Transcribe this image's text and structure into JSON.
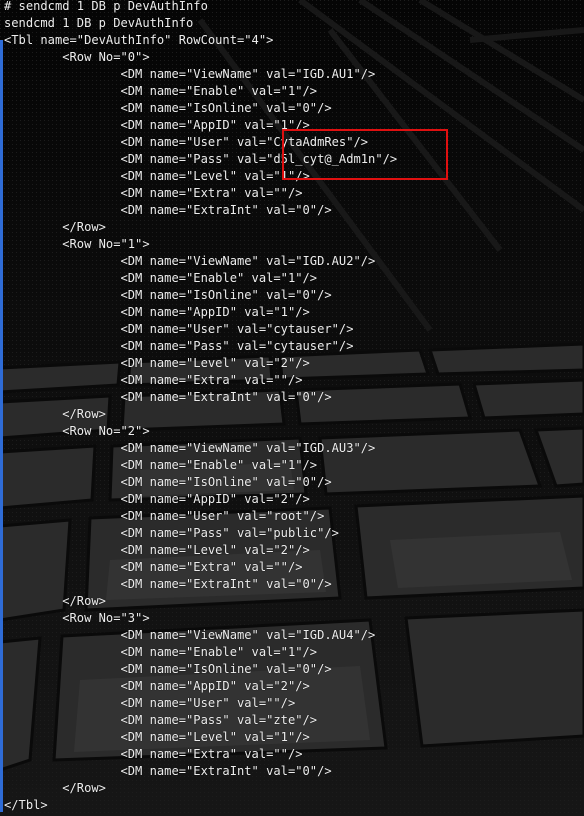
{
  "terminal": {
    "lines": [
      "# sendcmd 1 DB p DevAuthInfo",
      "sendcmd 1 DB p DevAuthInfo",
      "<Tbl name=\"DevAuthInfo\" RowCount=\"4\">",
      "        <Row No=\"0\">",
      "                <DM name=\"ViewName\" val=\"IGD.AU1\"/>",
      "                <DM name=\"Enable\" val=\"1\"/>",
      "                <DM name=\"IsOnline\" val=\"0\"/>",
      "                <DM name=\"AppID\" val=\"1\"/>",
      "                <DM name=\"User\" val=\"CytaAdmRes\"/>",
      "                <DM name=\"Pass\" val=\"d5l_cyt@_Adm1n\"/>",
      "                <DM name=\"Level\" val=\"1\"/>",
      "                <DM name=\"Extra\" val=\"\"/>",
      "                <DM name=\"ExtraInt\" val=\"0\"/>",
      "        </Row>",
      "        <Row No=\"1\">",
      "                <DM name=\"ViewName\" val=\"IGD.AU2\"/>",
      "                <DM name=\"Enable\" val=\"1\"/>",
      "                <DM name=\"IsOnline\" val=\"0\"/>",
      "                <DM name=\"AppID\" val=\"1\"/>",
      "                <DM name=\"User\" val=\"cytauser\"/>",
      "                <DM name=\"Pass\" val=\"cytauser\"/>",
      "                <DM name=\"Level\" val=\"2\"/>",
      "                <DM name=\"Extra\" val=\"\"/>",
      "                <DM name=\"ExtraInt\" val=\"0\"/>",
      "        </Row>",
      "        <Row No=\"2\">",
      "                <DM name=\"ViewName\" val=\"IGD.AU3\"/>",
      "                <DM name=\"Enable\" val=\"1\"/>",
      "                <DM name=\"IsOnline\" val=\"0\"/>",
      "                <DM name=\"AppID\" val=\"2\"/>",
      "                <DM name=\"User\" val=\"root\"/>",
      "                <DM name=\"Pass\" val=\"public\"/>",
      "                <DM name=\"Level\" val=\"2\"/>",
      "                <DM name=\"Extra\" val=\"\"/>",
      "                <DM name=\"ExtraInt\" val=\"0\"/>",
      "        </Row>",
      "        <Row No=\"3\">",
      "                <DM name=\"ViewName\" val=\"IGD.AU4\"/>",
      "                <DM name=\"Enable\" val=\"1\"/>",
      "                <DM name=\"IsOnline\" val=\"0\"/>",
      "                <DM name=\"AppID\" val=\"2\"/>",
      "                <DM name=\"User\" val=\"\"/>",
      "                <DM name=\"Pass\" val=\"zte\"/>",
      "                <DM name=\"Level\" val=\"1\"/>",
      "                <DM name=\"Extra\" val=\"\"/>",
      "                <DM name=\"ExtraInt\" val=\"0\"/>",
      "        </Row>",
      "</Tbl>"
    ]
  },
  "colors": {
    "text": "#ededed",
    "highlight_border": "#e01010",
    "accent_bar": "#2f6cd6",
    "background": "#0b0b0b"
  }
}
